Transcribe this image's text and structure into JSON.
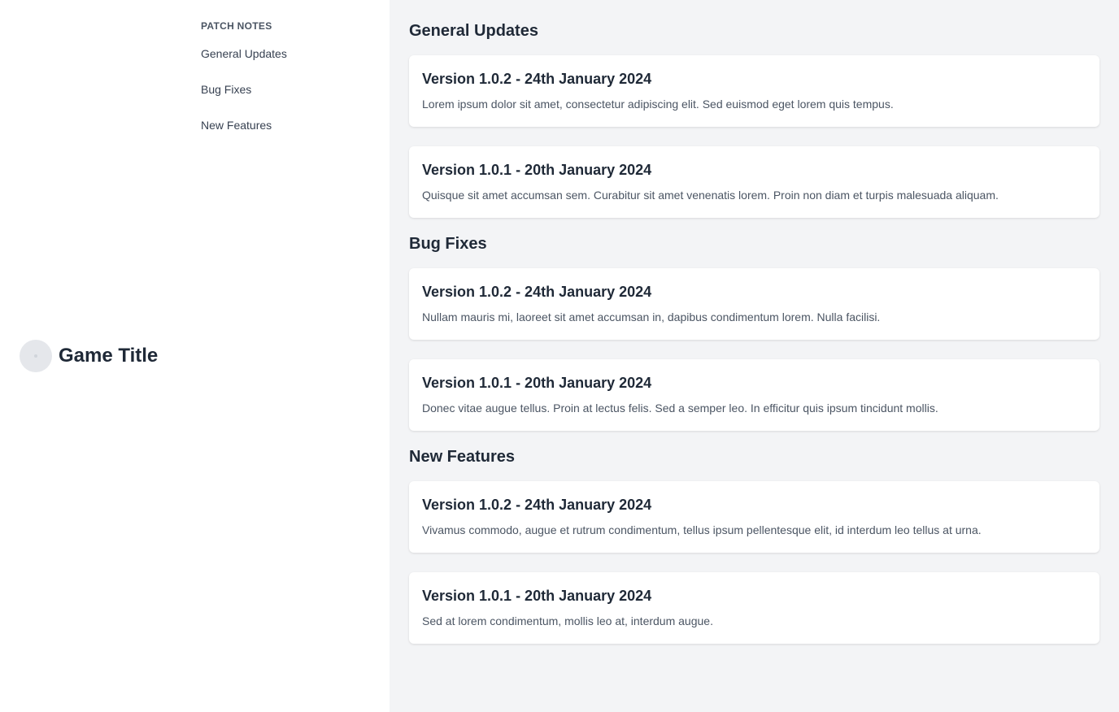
{
  "brand": {
    "title": "Game Title",
    "logo_icon": "game-logo-icon"
  },
  "sidebar": {
    "heading": "PATCH NOTES",
    "items": [
      {
        "label": "General Updates"
      },
      {
        "label": "Bug Fixes"
      },
      {
        "label": "New Features"
      }
    ]
  },
  "sections": [
    {
      "title": "General Updates",
      "cards": [
        {
          "title": "Version 1.0.2 - 24th January 2024",
          "text": "Lorem ipsum dolor sit amet, consectetur adipiscing elit. Sed euismod eget lorem quis tempus."
        },
        {
          "title": "Version 1.0.1 - 20th January 2024",
          "text": "Quisque sit amet accumsan sem. Curabitur sit amet venenatis lorem. Proin non diam et turpis malesuada aliquam."
        }
      ]
    },
    {
      "title": "Bug Fixes",
      "cards": [
        {
          "title": "Version 1.0.2 - 24th January 2024",
          "text": "Nullam mauris mi, laoreet sit amet accumsan in, dapibus condimentum lorem. Nulla facilisi."
        },
        {
          "title": "Version 1.0.1 - 20th January 2024",
          "text": "Donec vitae augue tellus. Proin at lectus felis. Sed a semper leo. In efficitur quis ipsum tincidunt mollis."
        }
      ]
    },
    {
      "title": "New Features",
      "cards": [
        {
          "title": "Version 1.0.2 - 24th January 2024",
          "text": "Vivamus commodo, augue et rutrum condimentum, tellus ipsum pellentesque elit, id interdum leo tellus at urna."
        },
        {
          "title": "Version 1.0.1 - 20th January 2024",
          "text": "Sed at lorem condimentum, mollis leo at, interdum augue."
        }
      ]
    }
  ]
}
